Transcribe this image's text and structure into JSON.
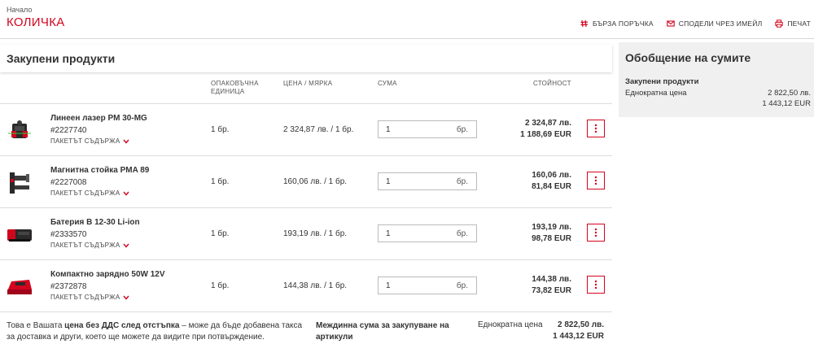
{
  "header": {
    "breadcrumb": "Начало",
    "title": "КОЛИЧКА",
    "actions": [
      {
        "label": "БЪРЗА ПОРЪЧКА",
        "icon": "quick-order-icon"
      },
      {
        "label": "СПОДЕЛИ ЧРЕЗ ИМЕЙЛ",
        "icon": "email-icon"
      },
      {
        "label": "ПЕЧАТ",
        "icon": "print-icon"
      }
    ]
  },
  "cart": {
    "heading": "Закупени продукти",
    "columns": {
      "packaging": "ОПАКОВЪЧНА ЕДИНИЦА",
      "price": "ЦЕНА / МЯРКА",
      "amount": "СУМА",
      "value": "СТОЙНОСТ"
    },
    "package_contents_label": "ПАКЕТЪТ СЪДЪРЖА",
    "items": [
      {
        "name": "Линеен лазер PM 30-MG",
        "sku": "#2227740",
        "unit": "1 бр.",
        "price": "2 324,87 лв. / 1 бр.",
        "qty": "1",
        "qty_unit": "бр.",
        "value_bgn": "2 324,87 лв.",
        "value_eur": "1 188,69 EUR",
        "image": "laser-level-icon"
      },
      {
        "name": "Магнитна стойка PMA 89",
        "sku": "#2227008",
        "unit": "1 бр.",
        "price": "160,06 лв. / 1 бр.",
        "qty": "1",
        "qty_unit": "бр.",
        "value_bgn": "160,06 лв.",
        "value_eur": "81,84 EUR",
        "image": "magnetic-mount-icon"
      },
      {
        "name": "Батерия B 12-30 Li-ion",
        "sku": "#2333570",
        "unit": "1 бр.",
        "price": "193,19 лв. / 1 бр.",
        "qty": "1",
        "qty_unit": "бр.",
        "value_bgn": "193,19 лв.",
        "value_eur": "98,78 EUR",
        "image": "battery-icon"
      },
      {
        "name": "Компактно зарядно 50W 12V",
        "sku": "#2372878",
        "unit": "1 бр.",
        "price": "144,38 лв. / 1 бр.",
        "qty": "1",
        "qty_unit": "бр.",
        "value_bgn": "144,38 лв.",
        "value_eur": "73,82 EUR",
        "image": "charger-icon"
      }
    ],
    "footer": {
      "note_prefix": "Това е Вашата ",
      "note_bold": "цена без ДДС след отстъпка",
      "note_suffix": " – може да бъде добавена такса за доставка и други, което ще можете да видите при потвърждение.",
      "subtotal_label": "Междинна сума за закупуване на артикули",
      "once_label": "Еднократна цена",
      "total_bgn": "2 822,50 лв.",
      "total_eur": "1 443,12 EUR"
    }
  },
  "summary": {
    "heading": "Обобщение на сумите",
    "label": "Закупени продукти",
    "once_label": "Еднократна цена",
    "total_bgn": "2 822,50 лв.",
    "total_eur": "1 443,12 EUR"
  },
  "colors": {
    "accent": "#d2051e",
    "panel": "#f0f0f0"
  }
}
